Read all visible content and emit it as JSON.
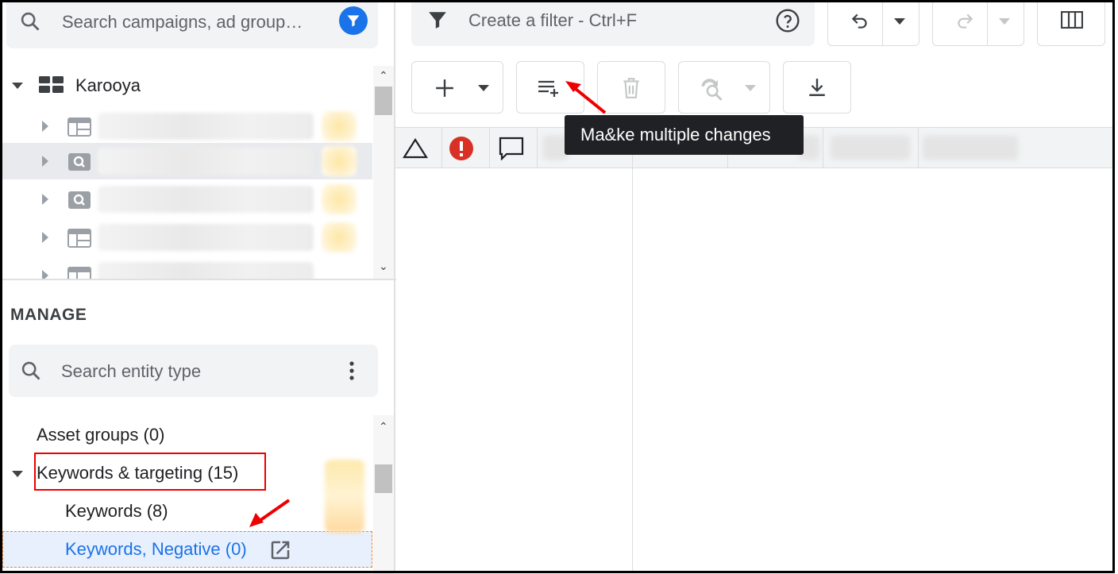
{
  "left_panel": {
    "search_placeholder": "Search campaigns, ad group…",
    "account_name": "Karooya",
    "campaign_rows": [
      {
        "icon": "display-campaign-icon"
      },
      {
        "icon": "search-campaign-icon",
        "selected": true
      },
      {
        "icon": "search-campaign-icon"
      },
      {
        "icon": "display-campaign-icon"
      },
      {
        "icon": "display-campaign-icon"
      }
    ],
    "manage_heading": "MANAGE",
    "entity_search_placeholder": "Search entity type",
    "entities": {
      "asset_groups": "Asset groups (0)",
      "keywords_targeting": "Keywords & targeting (15)",
      "keywords": "Keywords (8)",
      "keywords_negative": "Keywords, Negative (0)"
    }
  },
  "right_panel": {
    "filter_placeholder": "Create a filter - Ctrl+F",
    "tooltip": "Ma&ke multiple changes"
  },
  "colors": {
    "accent": "#1a73e8",
    "annotation_red": "#e00000",
    "error_red": "#d93025",
    "tooltip_bg": "#202124"
  }
}
